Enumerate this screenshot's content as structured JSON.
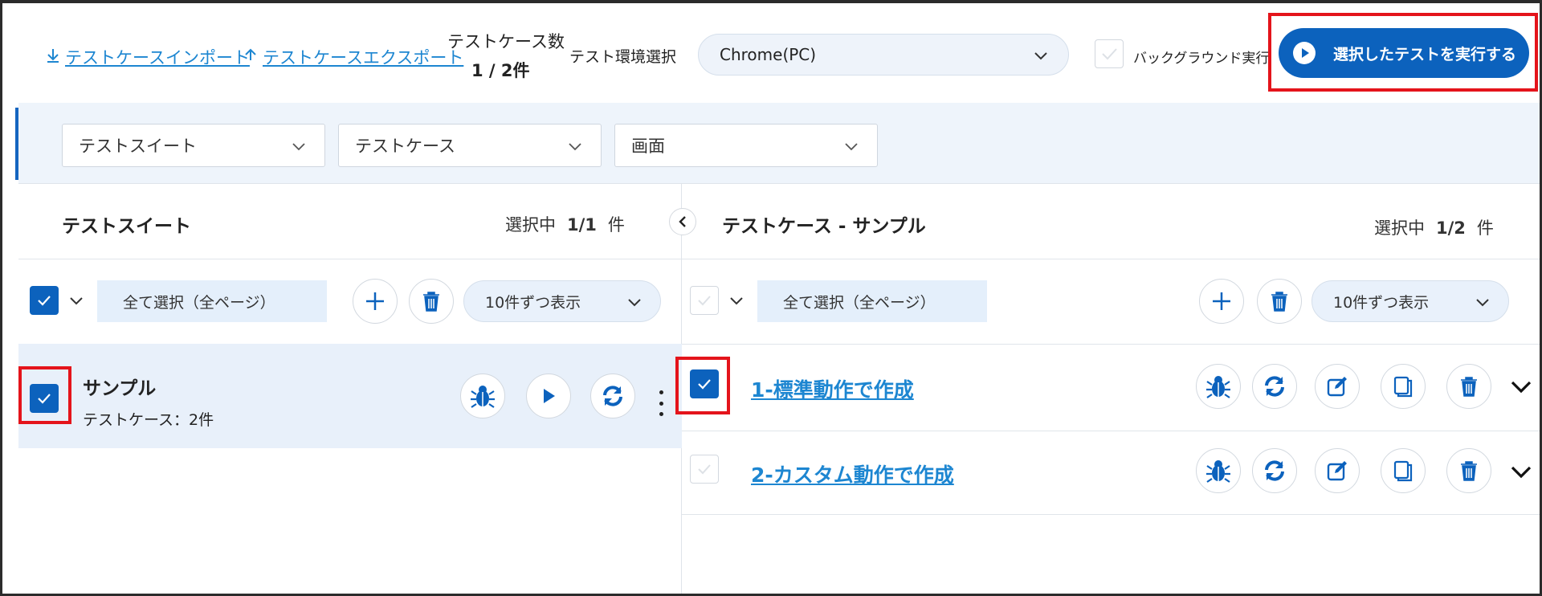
{
  "toolbar": {
    "import_label": "テストケースインポート",
    "export_label": "テストケースエクスポート",
    "count_label": "テストケース数",
    "count_value": "1 / 2件",
    "env_label": "テスト環境選択",
    "env_value": "Chrome(PC)",
    "background_label": "バックグラウンド実行",
    "run_label": "選択したテストを実行する"
  },
  "filters": {
    "suite": "テストスイート",
    "case": "テストケース",
    "screen": "画面"
  },
  "left_panel": {
    "title": "テストスイート",
    "selected_prefix": "選択中",
    "selected_count": "1/1",
    "selected_suffix": "件",
    "select_all": "全て選択（全ページ）",
    "per_page": "10件ずつ表示",
    "items": [
      {
        "name": "サンプル",
        "sub": "テストケース：2件",
        "checked": true
      }
    ]
  },
  "right_panel": {
    "title": "テストケース - サンプル",
    "selected_prefix": "選択中",
    "selected_count": "1/2",
    "selected_suffix": "件",
    "select_all": "全て選択（全ページ）",
    "per_page": "10件ずつ表示",
    "items": [
      {
        "name": "1-標準動作で作成",
        "checked": true
      },
      {
        "name": "2-カスタム動作で作成",
        "checked": false
      }
    ]
  },
  "colors": {
    "accent": "#0c62bd",
    "link": "#1d86d1",
    "highlight": "#e4141b",
    "filter_bg": "#eef4fb",
    "selected_row_bg": "#e8f0fa"
  },
  "icons": [
    "download-icon",
    "upload-icon",
    "chevron-down-icon",
    "check-icon",
    "play-icon",
    "plus-icon",
    "trash-icon",
    "bug-icon",
    "refresh-icon",
    "edit-icon",
    "copy-icon",
    "chevron-left-icon",
    "kebab-icon"
  ]
}
